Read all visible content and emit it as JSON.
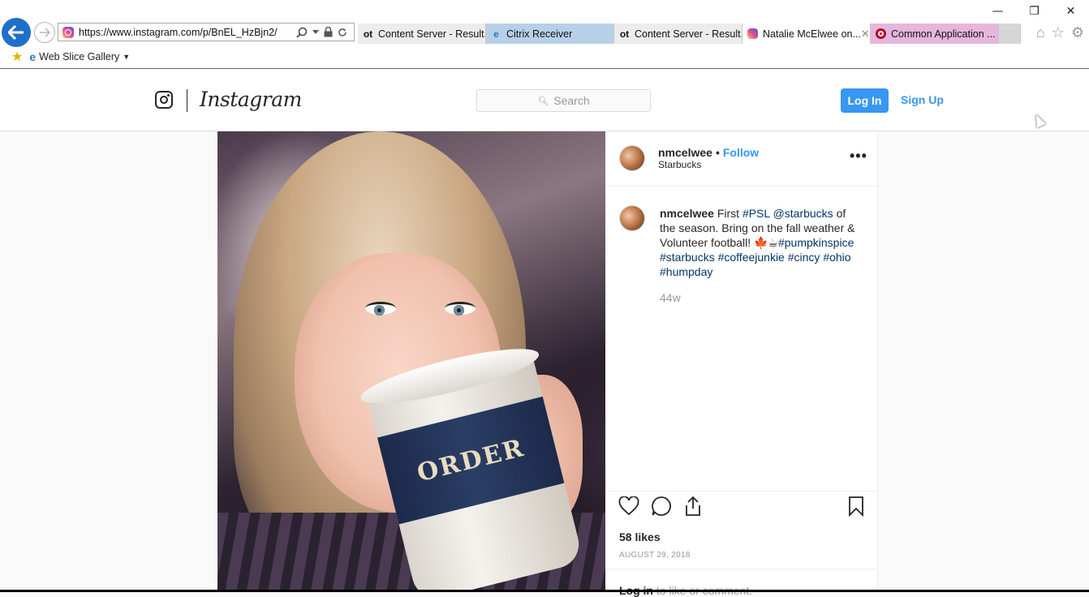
{
  "browser": {
    "url_prefix": "https://www.",
    "url_host": "instagram.com",
    "url_path": "/p/BnEL_HzBjn2/",
    "tabs": [
      {
        "icon": "ot",
        "label": "Content Server - Result..."
      },
      {
        "icon": "e",
        "label": "Citrix Receiver"
      },
      {
        "icon": "ot",
        "label": "Content Server - Result..."
      },
      {
        "icon": "ig",
        "label": "Natalie McElwee on..."
      },
      {
        "icon": "c",
        "label": "Common Application ..."
      }
    ],
    "favorites": {
      "web_slice_label": "Web Slice Gallery"
    },
    "window": {
      "minimize": "—",
      "restore": "❐",
      "close": "✕"
    }
  },
  "instagram": {
    "wordmark": "Instagram",
    "search_placeholder": "Search",
    "login_label": "Log In",
    "signup_label": "Sign Up"
  },
  "post": {
    "username": "nmcelwee",
    "follow_label": "Follow",
    "dot": "•",
    "location": "Starbucks",
    "caption": {
      "username": "nmcelwee",
      "text_1": " First ",
      "tag_psl": "#PSL",
      "mention": "@starbucks",
      "text_2": " of the season. Bring on the fall weather & Volunteer football! ",
      "emoji": "🍁☕",
      "tag_pumpkinspice": "#pumpkinspice",
      "tag_starbucks": "#starbucks",
      "tag_coffeejunkie": "#coffeejunkie",
      "tag_cincy": "#cincy",
      "tag_ohio": "#ohio",
      "tag_humpday": "#humpday"
    },
    "time_ago": "44w",
    "likes": "58 likes",
    "date": "AUGUST 29, 2018",
    "comment_login": "Log in",
    "comment_rest": " to like or comment.",
    "cup_text": "ORDER"
  }
}
